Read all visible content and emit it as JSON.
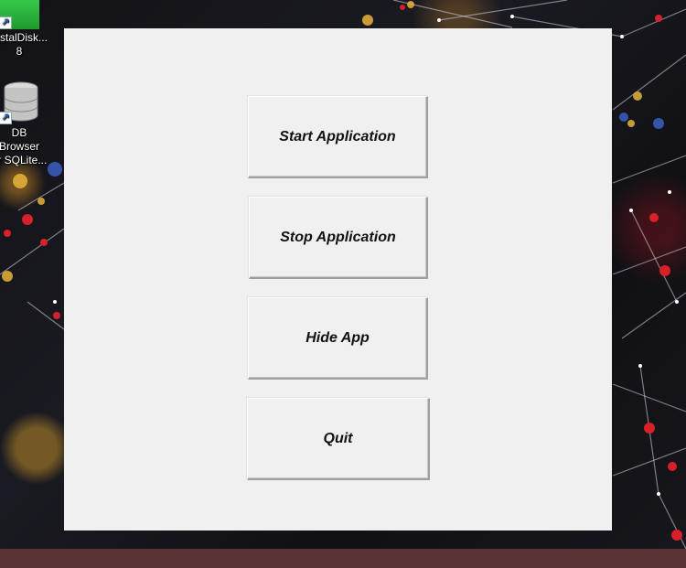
{
  "desktop": {
    "icons": [
      {
        "label_line1": "rystalDisk...",
        "label_line2": "8",
        "icon": "crystaldiskmark-icon"
      },
      {
        "label_line1": "DB Browser",
        "label_line2": "or SQLite...",
        "icon": "database-icon"
      }
    ]
  },
  "app": {
    "buttons": [
      {
        "label": "Start Application"
      },
      {
        "label": "Stop Application"
      },
      {
        "label": "Hide App"
      },
      {
        "label": "Quit"
      }
    ]
  },
  "colors": {
    "window_background": "#f0f0f0",
    "taskbar": "#5a3434",
    "button_text": "#111111"
  }
}
